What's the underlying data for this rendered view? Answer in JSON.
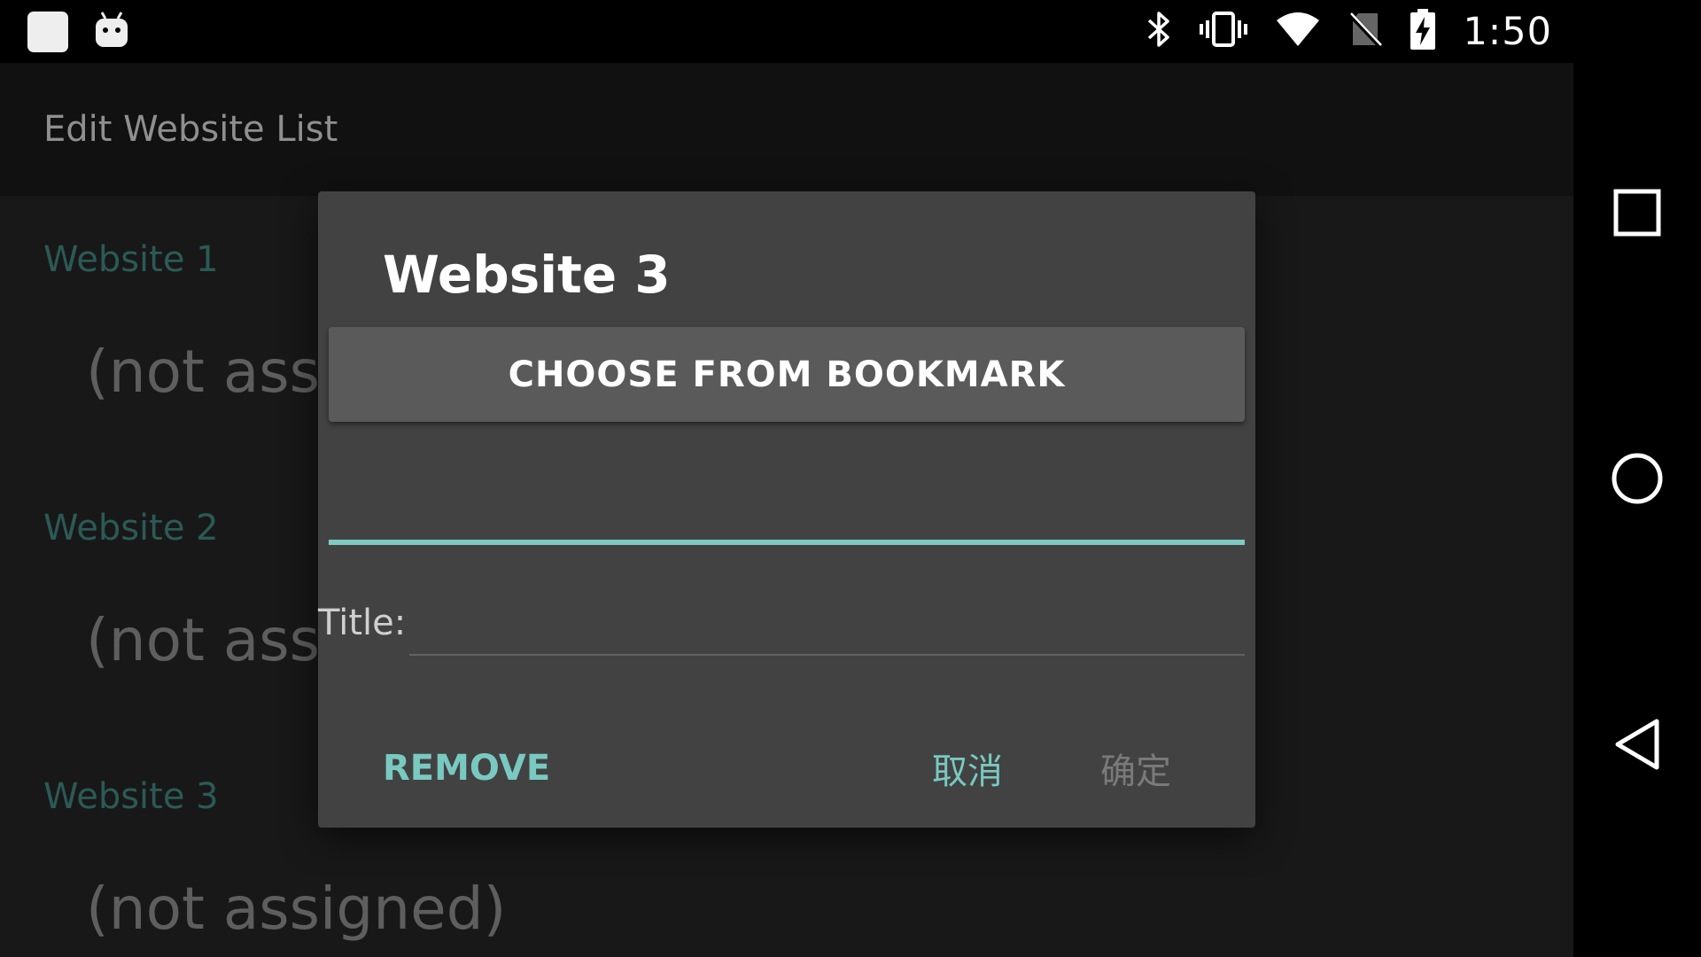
{
  "status_bar": {
    "time": "1:50",
    "left_icons": [
      "app-square-icon",
      "android-icon"
    ],
    "right_icons": [
      "bluetooth-icon",
      "vibrate-icon",
      "wifi-icon",
      "no-sim-icon",
      "battery-charging-icon"
    ]
  },
  "app": {
    "title": "Edit Website List",
    "websites": [
      {
        "label": "Website 1",
        "value": "(not assigned)"
      },
      {
        "label": "Website 2",
        "value": "(not assigned)"
      },
      {
        "label": "Website 3",
        "value": "(not assigned)"
      }
    ]
  },
  "dialog": {
    "title": "Website 3",
    "bookmark_button": "CHOOSE FROM BOOKMARK",
    "url_value": "",
    "title_label": "Title:",
    "title_value": "",
    "remove": "REMOVE",
    "cancel": "取消",
    "ok": "确定"
  },
  "nav_bar": {
    "buttons": [
      "recents-square-icon",
      "home-circle-icon",
      "back-triangle-icon"
    ]
  },
  "colors": {
    "accent": "#79c9c1",
    "dialog_bg": "#424242",
    "section_label": "#2b5a56",
    "disabled_text": "#7a7a7a"
  }
}
